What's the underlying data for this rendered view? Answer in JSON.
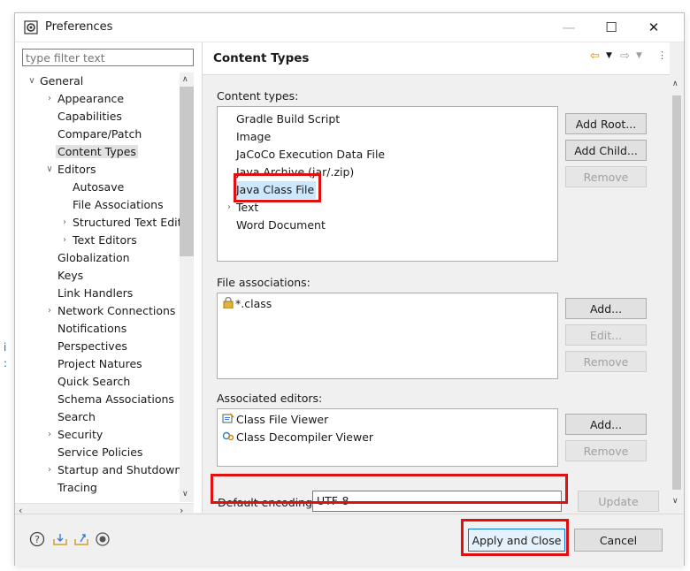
{
  "window": {
    "title": "Preferences",
    "minimize": "—",
    "maximize": "☐",
    "close": "✕"
  },
  "filter": {
    "placeholder": "type filter text"
  },
  "tree": [
    {
      "label": "General",
      "twisty": "∨"
    },
    {
      "label": "Appearance",
      "twisty": "›"
    },
    {
      "label": "Capabilities",
      "twisty": ""
    },
    {
      "label": "Compare/Patch",
      "twisty": ""
    },
    {
      "label": "Content Types",
      "twisty": "",
      "selected": true
    },
    {
      "label": "Editors",
      "twisty": "∨"
    },
    {
      "label": "Autosave",
      "twisty": ""
    },
    {
      "label": "File Associations",
      "twisty": ""
    },
    {
      "label": "Structured Text Edit",
      "twisty": "›"
    },
    {
      "label": "Text Editors",
      "twisty": "›"
    },
    {
      "label": "Globalization",
      "twisty": ""
    },
    {
      "label": "Keys",
      "twisty": ""
    },
    {
      "label": "Link Handlers",
      "twisty": ""
    },
    {
      "label": "Network Connections",
      "twisty": "›"
    },
    {
      "label": "Notifications",
      "twisty": ""
    },
    {
      "label": "Perspectives",
      "twisty": ""
    },
    {
      "label": "Project Natures",
      "twisty": ""
    },
    {
      "label": "Quick Search",
      "twisty": ""
    },
    {
      "label": "Schema Associations",
      "twisty": ""
    },
    {
      "label": "Search",
      "twisty": ""
    },
    {
      "label": "Security",
      "twisty": "›"
    },
    {
      "label": "Service Policies",
      "twisty": ""
    },
    {
      "label": "Startup and Shutdown",
      "twisty": "›"
    },
    {
      "label": "Tracing",
      "twisty": ""
    }
  ],
  "page": {
    "title": "Content Types",
    "content_types_label": "Content types:",
    "content_types": [
      {
        "label": "Gradle Build Script",
        "twisty": ""
      },
      {
        "label": "Image",
        "twisty": ""
      },
      {
        "label": "JaCoCo Execution Data File",
        "twisty": ""
      },
      {
        "label": "Java Archive (jar/.zip)",
        "twisty": ""
      },
      {
        "label": "Java Class File",
        "twisty": "",
        "selected": true
      },
      {
        "label": "Text",
        "twisty": "›"
      },
      {
        "label": "Word Document",
        "twisty": ""
      }
    ],
    "content_buttons": {
      "add_root": "Add Root...",
      "add_child": "Add Child...",
      "remove": "Remove"
    },
    "file_assoc_label": "File associations:",
    "file_assoc": [
      {
        "label": "*.class"
      }
    ],
    "file_assoc_buttons": {
      "add": "Add...",
      "edit": "Edit...",
      "remove": "Remove"
    },
    "editors_label": "Associated editors:",
    "editors": [
      {
        "label": "Class File Viewer"
      },
      {
        "label": "Class Decompiler Viewer"
      }
    ],
    "editor_buttons": {
      "add": "Add...",
      "remove": "Remove"
    },
    "encoding_label": "Default encoding:",
    "encoding_value": "UTF-8",
    "update": "Update"
  },
  "bottom": {
    "apply_close": "Apply and Close",
    "cancel": "Cancel"
  },
  "colors": {
    "highlight": "#e01010",
    "selection": "#cce8ff"
  }
}
